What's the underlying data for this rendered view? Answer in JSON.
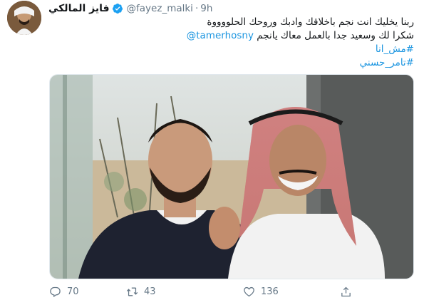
{
  "author": {
    "display_name": "فايز المالكي",
    "handle": "@fayez_malki",
    "separator": "·",
    "time": "9h"
  },
  "tweet": {
    "line1": "ربنا يخليك انت نجم باخلاقك وادبك وروحك الحلووووة",
    "line2_text": "شكرا لك وسعيد جدا بالعمل معاك يانجم",
    "line2_mention": "@tamerhosny",
    "hashtag1": "#مش_انا",
    "hashtag2": "#تامر_حسني"
  },
  "actions": {
    "replies": "70",
    "retweets": "43",
    "likes": "136"
  },
  "icons": [
    "verified-badge-icon",
    "reply-icon",
    "retweet-icon",
    "like-icon",
    "share-icon"
  ],
  "colors": {
    "link": "#1b95e0",
    "muted": "#657786",
    "verified": "#1da1f2"
  }
}
